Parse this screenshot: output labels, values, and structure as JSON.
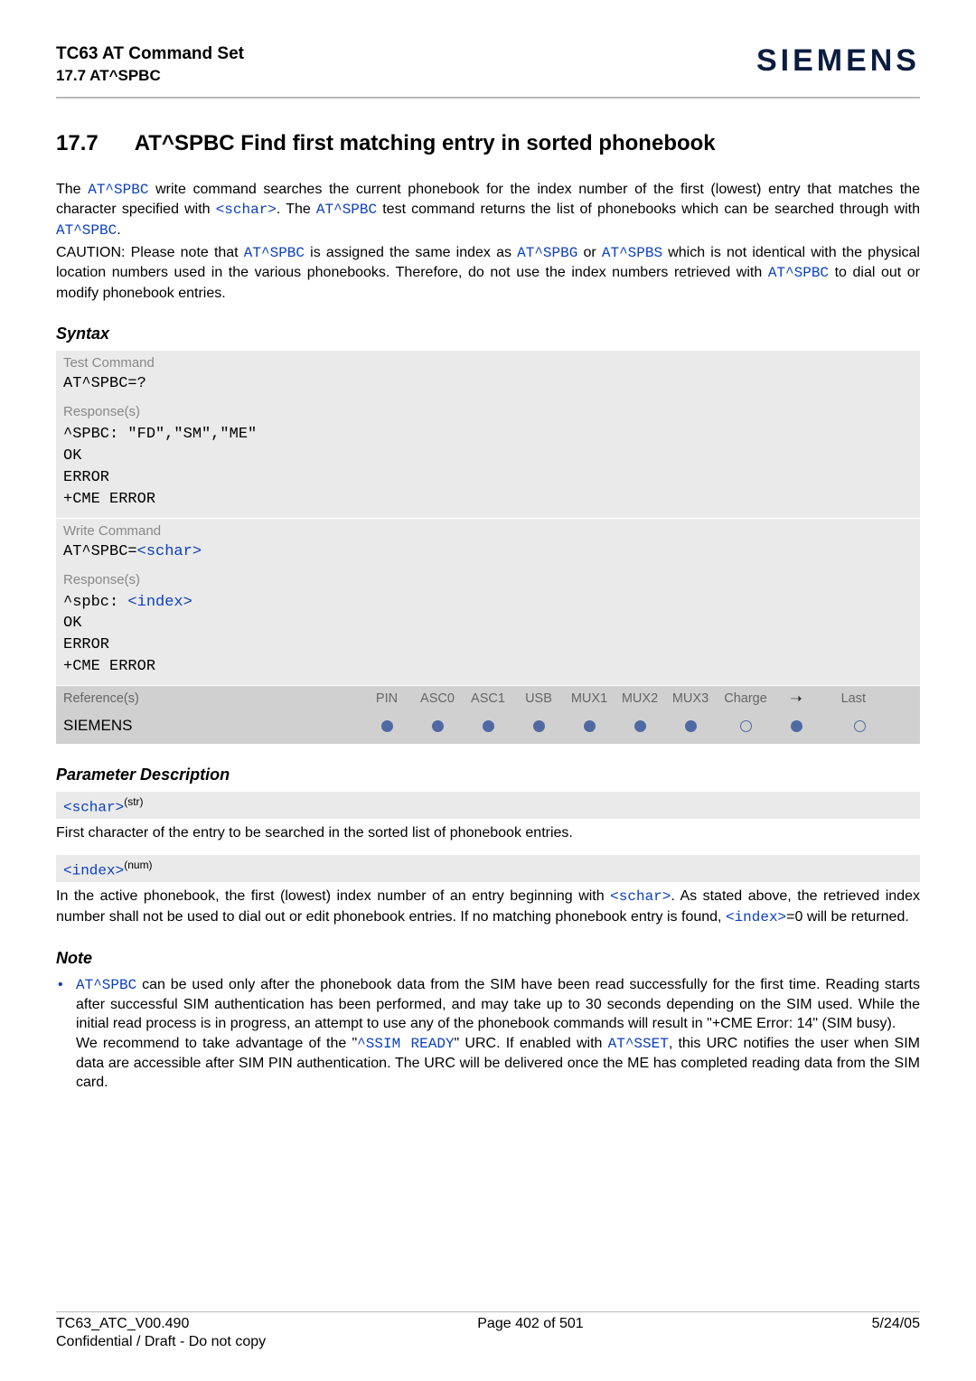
{
  "header": {
    "title": "TC63 AT Command Set",
    "subsection": "17.7 AT^SPBC",
    "brand": "SIEMENS"
  },
  "section": {
    "number": "17.7",
    "title": "AT^SPBC   Find first matching entry in sorted phonebook"
  },
  "body": {
    "p1a": "The ",
    "p1b": "AT^SPBC",
    "p1c": " write command searches the current phonebook for the index number of the first (lowest) entry that matches the character specified with ",
    "p1d": "<schar>",
    "p1e": ". The ",
    "p1f": "AT^SPBC",
    "p1g": " test command returns the list of phonebooks which can be searched through with ",
    "p1h": "AT^SPBC",
    "p1i": ".",
    "p2a": "CAUTION: Please note that ",
    "p2b": "AT^SPBC",
    "p2c": " is assigned the same index as ",
    "p2d": "AT^SPBG",
    "p2e": " or ",
    "p2f": "AT^SPBS",
    "p2g": " which is not identical with the physical location numbers used in the various phonebooks. Therefore, do not use the index numbers retrieved with ",
    "p2h": "AT^SPBC",
    "p2i": " to dial out or modify phonebook entries."
  },
  "syntax": {
    "label": "Syntax",
    "test_label": "Test Command",
    "test_cmd": "AT^SPBC=?",
    "resp_label": "Response(s)",
    "test_resp_l1": "^SPBC: \"FD\",\"SM\",\"ME\"",
    "ok": "OK",
    "error": "ERROR",
    "cme": "+CME ERROR",
    "write_label": "Write Command",
    "write_cmd_pre": "AT^SPBC=",
    "write_cmd_arg": "<schar>",
    "write_resp_l1_pre": "^spbc: ",
    "write_resp_l1_arg": "<index>",
    "ref_label": "Reference(s)",
    "cols": {
      "c1": "PIN",
      "c2": "ASC0",
      "c3": "ASC1",
      "c4": "USB",
      "c5": "MUX1",
      "c6": "MUX2",
      "c7": "MUX3",
      "c8": "Charge",
      "c9": "➝",
      "c10": "Last"
    },
    "siemens": "SIEMENS"
  },
  "params": {
    "heading": "Parameter Description",
    "schar": "<schar>",
    "schar_sup": "(str)",
    "schar_text": "First character of the entry to be searched in the sorted list of phonebook entries.",
    "index": "<index>",
    "index_sup": "(num)",
    "idx_a": "In the active phonebook, the first (lowest) index number of an entry beginning with ",
    "idx_b": "<schar>",
    "idx_c": ". As stated above, the retrieved index number shall not be used to dial out or edit phonebook entries. If no matching phonebook entry is found, ",
    "idx_d": "<index>",
    "idx_e": "=0 will be returned."
  },
  "note": {
    "heading": "Note",
    "n1a": "AT^SPBC",
    "n1b": " can be used only after the phonebook data from the SIM have been read successfully for the first time. Reading starts after successful SIM authentication has been performed, and may take up to 30 seconds depending on the SIM used. While the initial read process is in progress, an attempt to use any of the phonebook commands will result in \"+CME Error: 14\" (SIM busy).",
    "n2a": "We recommend to take advantage of the \"",
    "n2b": "^SSIM READY",
    "n2c": "\" URC. If enabled with ",
    "n2d": "AT^SSET",
    "n2e": ", this URC notifies the user when SIM data are accessible after SIM PIN authentication. The URC will be delivered once the ME has completed reading data from the SIM card."
  },
  "footer": {
    "left": "TC63_ATC_V00.490",
    "center": "Page 402 of 501",
    "right": "5/24/05",
    "line2": "Confidential / Draft - Do not copy"
  }
}
